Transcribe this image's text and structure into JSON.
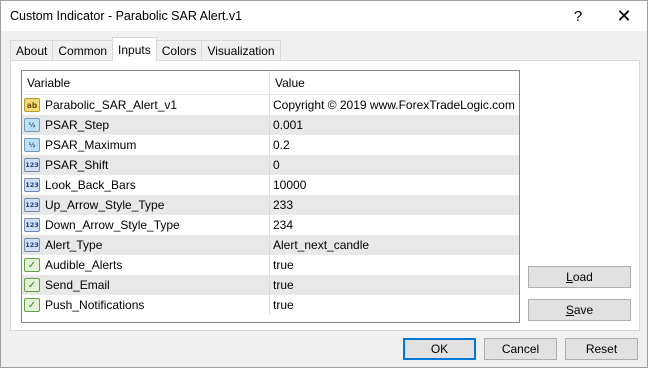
{
  "window": {
    "title": "Custom Indicator - Parabolic SAR Alert.v1",
    "help_glyph": "?",
    "close_glyph": "✕"
  },
  "tabs": [
    {
      "label": "About"
    },
    {
      "label": "Common"
    },
    {
      "label": "Inputs",
      "active": true
    },
    {
      "label": "Colors"
    },
    {
      "label": "Visualization"
    }
  ],
  "grid": {
    "columns": {
      "variable": "Variable",
      "value": "Value"
    },
    "rows": [
      {
        "icon": "string-type-icon",
        "icon_text": "ab",
        "variable": "Parabolic_SAR_Alert_v1",
        "value": "Copyright © 2019 www.ForexTradeLogic.com"
      },
      {
        "icon": "double-type-icon",
        "icon_text": "½",
        "variable": "PSAR_Step",
        "value": "0.001"
      },
      {
        "icon": "double-type-icon",
        "icon_text": "½",
        "variable": "PSAR_Maximum",
        "value": "0.2"
      },
      {
        "icon": "integer-type-icon",
        "icon_text": "123",
        "variable": "PSAR_Shift",
        "value": "0"
      },
      {
        "icon": "integer-type-icon",
        "icon_text": "123",
        "variable": "Look_Back_Bars",
        "value": "10000"
      },
      {
        "icon": "integer-type-icon",
        "icon_text": "123",
        "variable": "Up_Arrow_Style_Type",
        "value": "233"
      },
      {
        "icon": "integer-type-icon",
        "icon_text": "123",
        "variable": "Down_Arrow_Style_Type",
        "value": "234"
      },
      {
        "icon": "integer-type-icon",
        "icon_text": "123",
        "variable": "Alert_Type",
        "value": "Alert_next_candle"
      },
      {
        "icon": "boolean-type-icon",
        "icon_text": "✓",
        "variable": "Audible_Alerts",
        "value": "true"
      },
      {
        "icon": "boolean-type-icon",
        "icon_text": "✓",
        "variable": "Send_Email",
        "value": "true"
      },
      {
        "icon": "boolean-type-icon",
        "icon_text": "✓",
        "variable": "Push_Notifications",
        "value": "true"
      }
    ]
  },
  "side_buttons": {
    "load": {
      "mnemonic": "L",
      "rest": "oad"
    },
    "save": {
      "mnemonic": "S",
      "rest": "ave"
    }
  },
  "footer": {
    "ok": "OK",
    "cancel": "Cancel",
    "reset": "Reset"
  }
}
